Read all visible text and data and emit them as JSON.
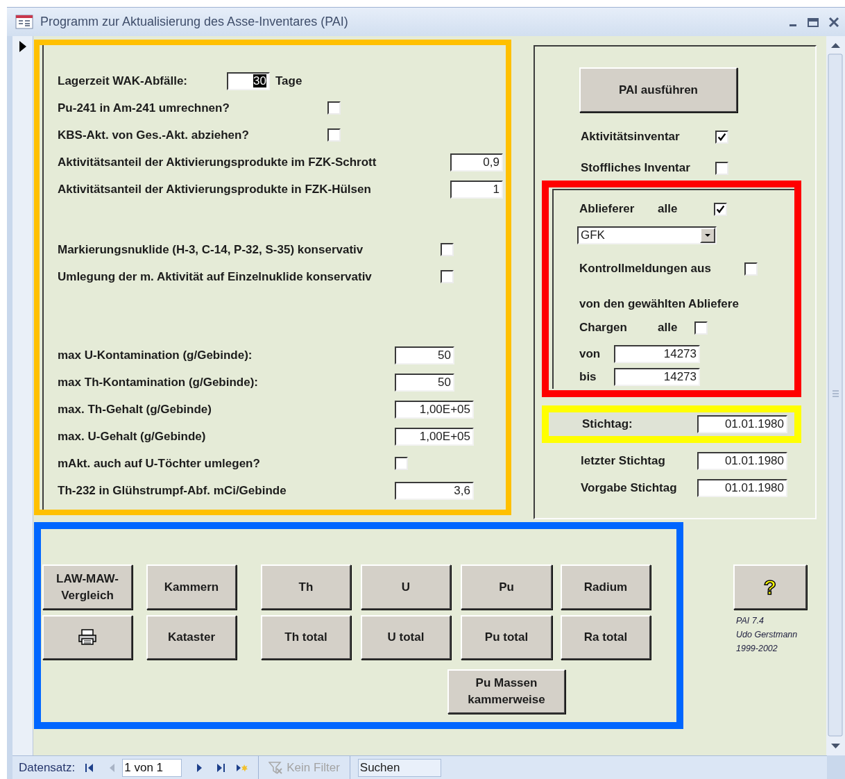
{
  "window": {
    "title": "Programm zur Aktualisierung des Asse-Inventares (PAI)"
  },
  "options": [
    {
      "kind": "input",
      "label": "Lagerzeit WAK-Abfälle:",
      "value": "30",
      "unit": "Tage",
      "text_selected": true
    },
    {
      "kind": "checkbox",
      "label": "Pu-241 in Am-241 umrechnen?",
      "checked": false
    },
    {
      "kind": "checkbox",
      "label": "KBS-Akt. von Ges.-Akt. abziehen?",
      "checked": false
    },
    {
      "kind": "input",
      "label": "Aktivitätsanteil der Aktivierungsprodukte im FZK-Schrott",
      "value": "0,9"
    },
    {
      "kind": "input",
      "label": "Aktivitätsanteil der Aktivierungsprodukte in FZK-Hülsen",
      "value": "1"
    },
    {
      "kind": "checkbox",
      "label": "Markierungsnuklide (H-3, C-14, P-32, S-35) konservativ",
      "checked": false
    },
    {
      "kind": "checkbox",
      "label": "Umlegung der m. Aktivität auf Einzelnuklide konservativ",
      "checked": false
    },
    {
      "kind": "input",
      "label": "max U-Kontamination (g/Gebinde):",
      "value": "50"
    },
    {
      "kind": "input",
      "label": "max Th-Kontamination (g/Gebinde):",
      "value": "50"
    },
    {
      "kind": "input",
      "label": "max. Th-Gehalt (g/Gebinde)",
      "value": "1,00E+05"
    },
    {
      "kind": "input",
      "label": "max. U-Gehalt (g/Gebinde)",
      "value": "1,00E+05"
    },
    {
      "kind": "checkbox",
      "label": "mAkt. auch auf U-Töchter umlegen?",
      "checked": false
    },
    {
      "kind": "input",
      "label": "Th-232 in Glühstrumpf-Abf. mCi/Gebinde",
      "value": "3,6"
    }
  ],
  "run_panel": {
    "run_button": "PAI ausführen",
    "inventories": [
      {
        "label": "Aktivitätsinventar",
        "checked": true
      },
      {
        "label": "Stoffliches Inventar",
        "checked": false
      }
    ]
  },
  "supplier_filter": {
    "label": "Ablieferer",
    "all_label": "alle",
    "all_checked": true,
    "supplier": "GFK",
    "messages_label": "Kontrollmeldungen aus",
    "messages_checked": false,
    "batches_heading": "von den gewählten Abliefere",
    "batches_label": "Chargen",
    "batches_all_label": "alle",
    "batches_all_checked": false,
    "from_label": "von",
    "from": "14273",
    "to_label": "bis",
    "to": "14273"
  },
  "dates": [
    {
      "label": "Stichtag:",
      "value": "01.01.1980"
    },
    {
      "label": "letzter Stichtag",
      "value": "01.01.1980"
    },
    {
      "label": "Vorgabe Stichtag",
      "value": "01.01.1980"
    }
  ],
  "reports": [
    [
      {
        "kind": "text",
        "label": "LAW-MAW-Vergleich"
      },
      {
        "kind": "text",
        "label": "Kammern"
      },
      {
        "kind": "text",
        "label": "Th"
      },
      {
        "kind": "text",
        "label": "U"
      },
      {
        "kind": "text",
        "label": "Pu"
      },
      {
        "kind": "text",
        "label": "Radium"
      }
    ],
    [
      {
        "kind": "print"
      },
      {
        "kind": "text",
        "label": "Kataster"
      },
      {
        "kind": "text",
        "label": "Th total"
      },
      {
        "kind": "text",
        "label": "U total"
      },
      {
        "kind": "text",
        "label": "Pu total"
      },
      {
        "kind": "text",
        "label": "Ra total"
      }
    ],
    [
      {
        "kind": "text",
        "label": "Pu Massen kammerweise"
      }
    ]
  ],
  "help": {
    "button": "?"
  },
  "about": [
    "PAI 7.4",
    "Udo Gerstmann",
    "1999-2002"
  ],
  "navigation": {
    "label": "Datensatz:",
    "position": "1 von 1",
    "buttons": [
      {
        "kind": "first",
        "disabled": false
      },
      {
        "kind": "previous",
        "disabled": true
      },
      {
        "kind": "next",
        "disabled": false
      },
      {
        "kind": "last",
        "disabled": false
      },
      {
        "kind": "new",
        "disabled": false
      }
    ],
    "filter": "Kein Filter",
    "filter_active": false,
    "search_placeholder": "Suchen"
  }
}
